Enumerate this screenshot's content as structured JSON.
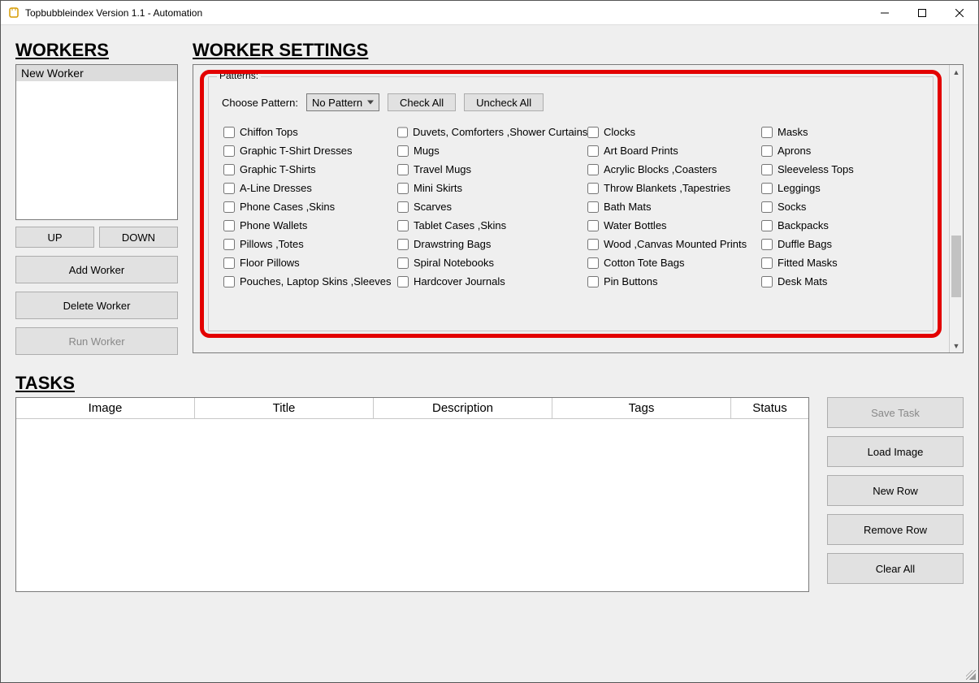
{
  "window": {
    "title": "Topbubbleindex Version 1.1 - Automation"
  },
  "sections": {
    "workers": "WORKERS",
    "settings": "WORKER SETTINGS",
    "tasks": "TASKS"
  },
  "workers": {
    "items": [
      "New Worker"
    ],
    "up": "UP",
    "down": "DOWN",
    "add": "Add Worker",
    "delete": "Delete Worker",
    "run": "Run Worker"
  },
  "patterns": {
    "legend": "Patterns:",
    "choose_label": "Choose Pattern:",
    "select_value": "No Pattern",
    "check_all": "Check All",
    "uncheck_all": "Uncheck All",
    "col1": [
      "Chiffon Tops",
      "Graphic T-Shirt Dresses",
      "Graphic T-Shirts",
      "A-Line Dresses",
      "Phone Cases ,Skins",
      "Phone Wallets",
      "Pillows ,Totes",
      "Floor Pillows",
      "Pouches, Laptop Skins ,Sleeves"
    ],
    "col2": [
      "Duvets, Comforters ,Shower Curtains",
      "Mugs",
      "Travel Mugs",
      "Mini Skirts",
      "Scarves",
      "Tablet Cases ,Skins",
      "Drawstring Bags",
      "Spiral Notebooks",
      "Hardcover Journals"
    ],
    "col3": [
      "Clocks",
      "Art Board Prints",
      "Acrylic Blocks ,Coasters",
      "Throw Blankets ,Tapestries",
      "Bath Mats",
      "Water Bottles",
      "Wood ,Canvas Mounted Prints",
      "Cotton Tote Bags",
      "Pin Buttons"
    ],
    "col4": [
      "Masks",
      "Aprons",
      "Sleeveless Tops",
      "Leggings",
      "Socks",
      "Backpacks",
      "Duffle Bags",
      "Fitted Masks",
      "Desk Mats"
    ]
  },
  "tasks": {
    "headers": {
      "image": "Image",
      "title": "Title",
      "description": "Description",
      "tags": "Tags",
      "status": "Status"
    },
    "buttons": {
      "save": "Save Task",
      "load": "Load Image",
      "new_row": "New Row",
      "remove_row": "Remove Row",
      "clear_all": "Clear All"
    }
  }
}
